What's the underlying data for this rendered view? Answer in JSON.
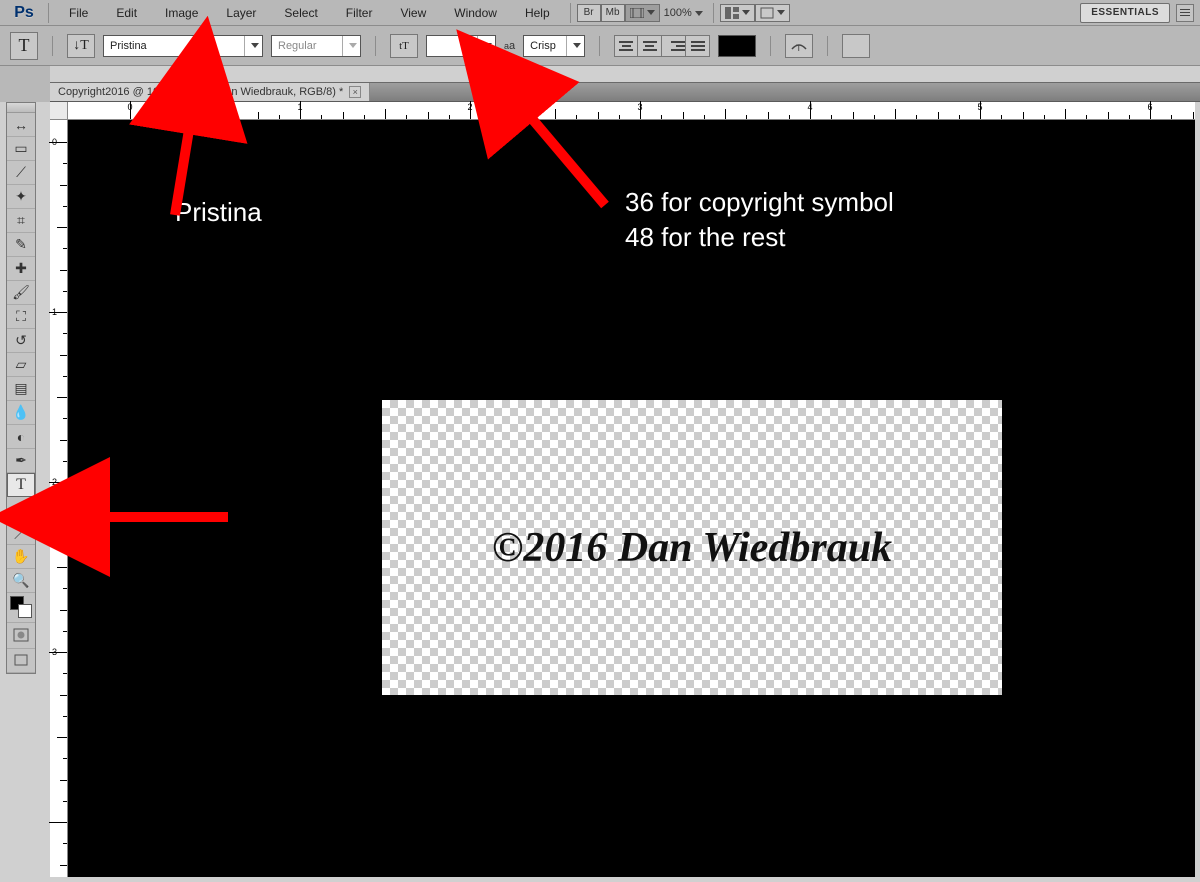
{
  "app": {
    "logo_text": "Ps"
  },
  "menu": {
    "items": [
      "File",
      "Edit",
      "Image",
      "Layer",
      "Select",
      "Filter",
      "View",
      "Window",
      "Help"
    ],
    "br_label": "Br",
    "mb_label": "Mb",
    "zoom_label": "100%",
    "essentials_label": "ESSENTIALS"
  },
  "options": {
    "tool_glyph": "T",
    "orientation_glyph": "↓T",
    "font_family": "Pristina",
    "font_style": "Regular",
    "size_icon_glyph": "tT",
    "size_value": "",
    "aa_prefix": "aa",
    "aa_value": "Crisp"
  },
  "document": {
    "tab_title": "Copyright2016 @ 100% (©2016 Dan Wiedbrauk, RGB/8) *",
    "close_glyph": "×"
  },
  "ruler": {
    "h_labels": [
      "0",
      "1",
      "2",
      "3",
      "4",
      "5",
      "6"
    ],
    "v_labels": [
      "0",
      "1",
      "2",
      "3"
    ]
  },
  "canvas": {
    "watermark_text": "©2016 Dan Wiedbrauk"
  },
  "annotations": {
    "font_label": "Pristina",
    "size_note_line1": "36 for copyright symbol",
    "size_note_line2": "48 for the rest"
  },
  "tools": {
    "items": [
      {
        "name": "move-tool",
        "glyph": "↔"
      },
      {
        "name": "marquee-tool",
        "glyph": "▭"
      },
      {
        "name": "lasso-tool",
        "glyph": "⟋"
      },
      {
        "name": "magic-wand-tool",
        "glyph": "✦"
      },
      {
        "name": "crop-tool",
        "glyph": "⌗"
      },
      {
        "name": "eyedropper-tool",
        "glyph": "✎"
      },
      {
        "name": "healing-brush-tool",
        "glyph": "✚"
      },
      {
        "name": "brush-tool",
        "glyph": "🖌"
      },
      {
        "name": "clone-stamp-tool",
        "glyph": "⛶"
      },
      {
        "name": "history-brush-tool",
        "glyph": "↺"
      },
      {
        "name": "eraser-tool",
        "glyph": "▱"
      },
      {
        "name": "gradient-tool",
        "glyph": "▤"
      },
      {
        "name": "blur-tool",
        "glyph": "💧"
      },
      {
        "name": "dodge-tool",
        "glyph": "◐"
      },
      {
        "name": "pen-tool",
        "glyph": "✒"
      },
      {
        "name": "type-tool",
        "glyph": "T",
        "selected": true
      },
      {
        "name": "path-select-tool",
        "glyph": "↖"
      },
      {
        "name": "line-tool",
        "glyph": "／"
      },
      {
        "name": "hand-tool",
        "glyph": "✋"
      },
      {
        "name": "zoom-tool",
        "glyph": "🔍"
      }
    ]
  }
}
